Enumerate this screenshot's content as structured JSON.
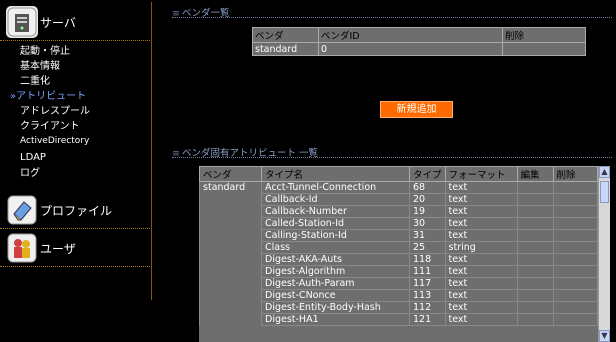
{
  "sidebar": {
    "server_label": "サーバ",
    "server_items": [
      {
        "label": "起動・停止",
        "active": false
      },
      {
        "label": "基本情報",
        "active": false
      },
      {
        "label": "二重化",
        "active": false
      },
      {
        "label": "アトリビュート",
        "active": true,
        "marker": "»"
      },
      {
        "label": "アドレスプール",
        "active": false
      },
      {
        "label": "クライアント",
        "active": false
      },
      {
        "label": "ActiveDirectory",
        "active": false
      },
      {
        "label": "LDAP",
        "active": false
      },
      {
        "label": "ログ",
        "active": false
      }
    ],
    "profile_label": "プロファイル",
    "user_label": "ユーザ"
  },
  "vendor_section": {
    "title": "ベンダ一覧",
    "headers": [
      "ベンダ",
      "ベンダID",
      "削除"
    ],
    "rows": [
      [
        "standard",
        "0",
        ""
      ]
    ]
  },
  "add_button": "新規追加",
  "attr_section": {
    "title": "ベンダ固有アトリビュート 一覧",
    "headers": [
      "ベンダ",
      "タイプ名",
      "タイプ",
      "フォーマット",
      "編集",
      "削除"
    ],
    "vendor": "standard",
    "rows": [
      [
        "Acct-Tunnel-Connection",
        "68",
        "text"
      ],
      [
        "Callback-Id",
        "20",
        "text"
      ],
      [
        "Callback-Number",
        "19",
        "text"
      ],
      [
        "Called-Station-Id",
        "30",
        "text"
      ],
      [
        "Calling-Station-Id",
        "31",
        "text"
      ],
      [
        "Class",
        "25",
        "string"
      ],
      [
        "Digest-AKA-Auts",
        "118",
        "text"
      ],
      [
        "Digest-Algorithm",
        "111",
        "text"
      ],
      [
        "Digest-Auth-Param",
        "117",
        "text"
      ],
      [
        "Digest-CNonce",
        "113",
        "text"
      ],
      [
        "Digest-Entity-Body-Hash",
        "112",
        "text"
      ],
      [
        "Digest-HA1",
        "121",
        "text"
      ]
    ]
  },
  "colors": {
    "accent_button": "#ff6a00",
    "active_menu": "#7aa0ff",
    "table_bg": "#6e6e6e"
  }
}
